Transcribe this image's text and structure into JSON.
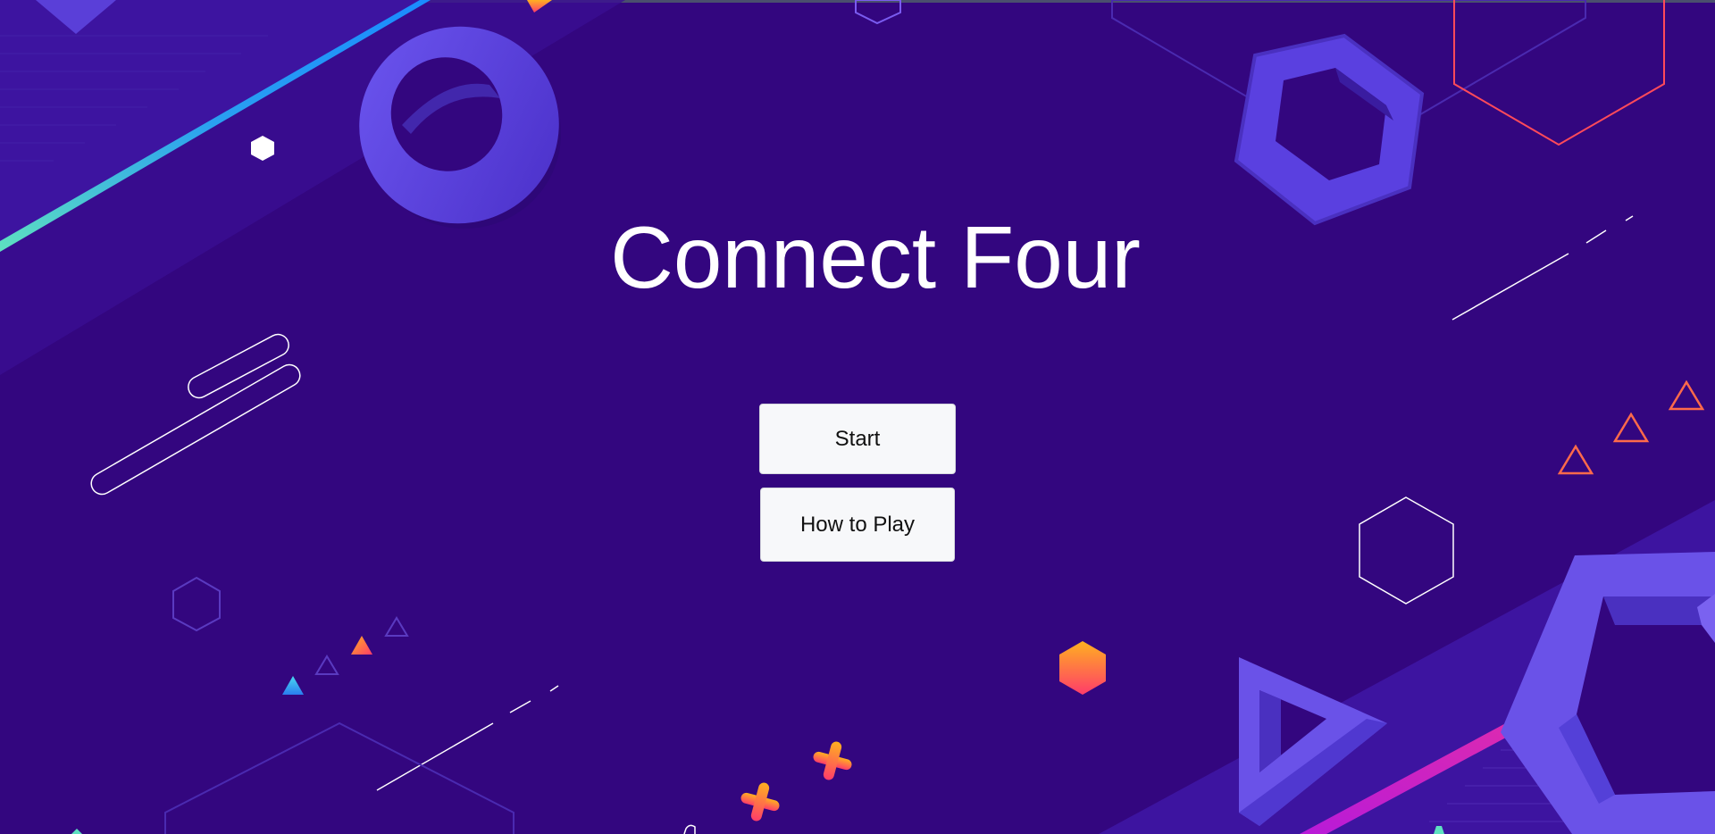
{
  "game": {
    "title": "Connect Four"
  },
  "menu": {
    "start_label": "Start",
    "howto_label": "How to Play"
  },
  "colors": {
    "background": "#33067f",
    "button_bg": "#f7f8fa",
    "title_text": "#ffffff",
    "accent_orange": "#ff8a2a",
    "accent_purple": "#6a4ce8"
  }
}
